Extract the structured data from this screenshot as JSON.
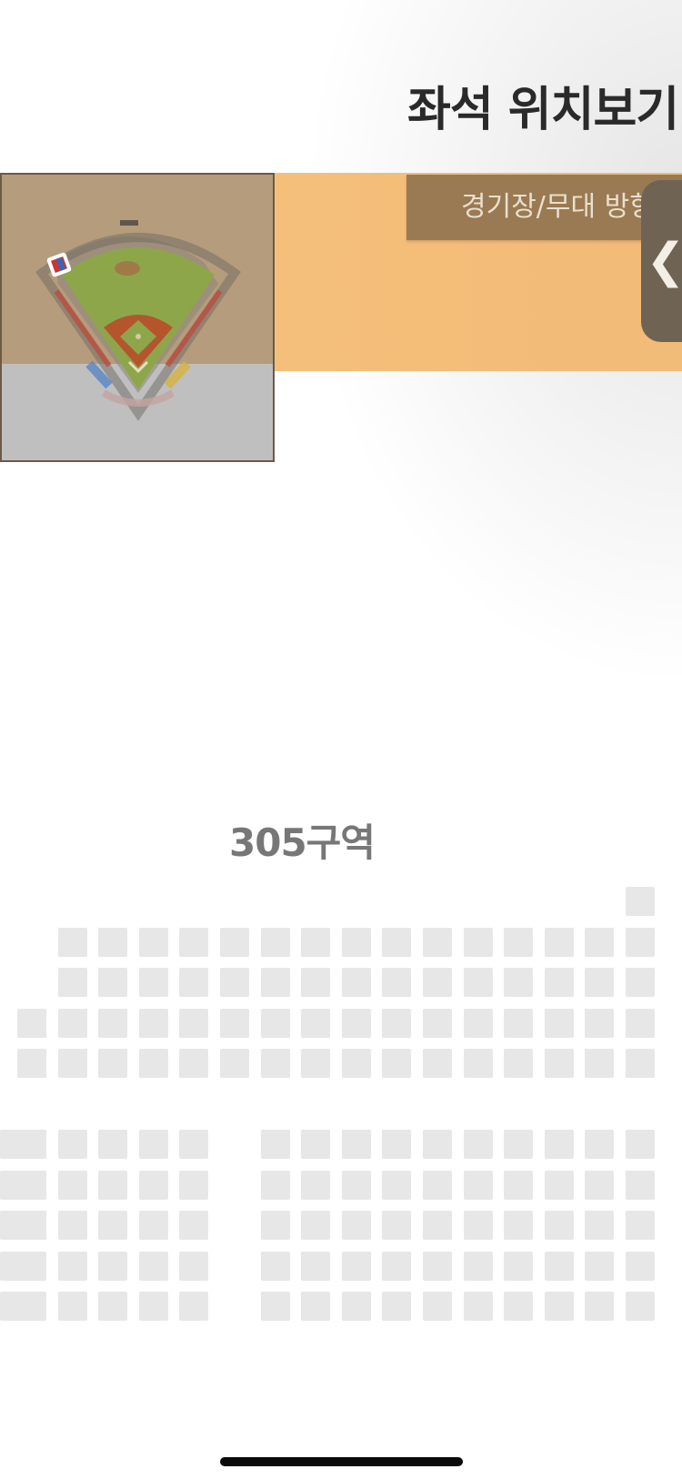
{
  "header": {
    "title": "좌석 위치보기"
  },
  "direction_button": {
    "label": "경기장/무대 방향"
  },
  "side_tab": {
    "icon": "chevron-left-icon",
    "glyph": "❮"
  },
  "stadium_map": {
    "icon": "stadium-map-icon"
  },
  "section": {
    "label": "305구역"
  },
  "colors": {
    "accent_orange": "#f6c27e",
    "button_brown": "#9a7a52",
    "tab_dark": "#6f6354",
    "seat_gray": "#e7e7e7"
  }
}
